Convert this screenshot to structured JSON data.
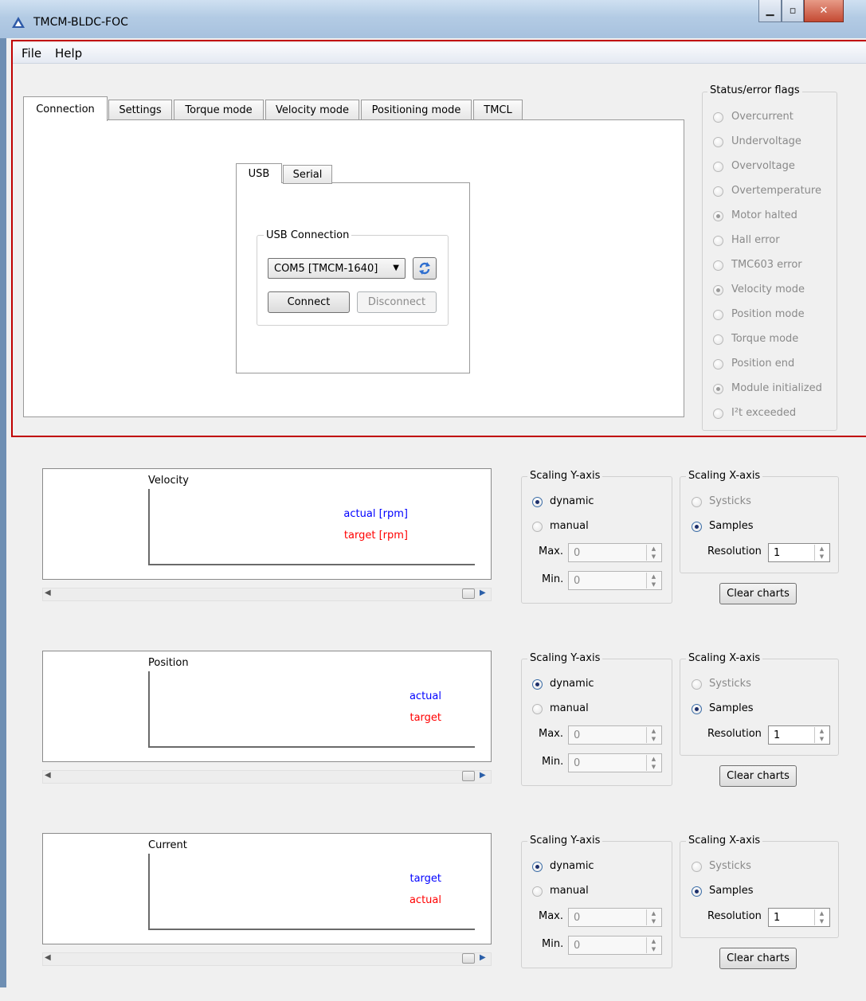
{
  "window": {
    "title": "TMCM-BLDC-FOC",
    "min_icon": "minimize-icon",
    "max_icon": "maximize-icon",
    "close_icon": "close-icon"
  },
  "menu": {
    "file": "File",
    "help": "Help"
  },
  "tabs": [
    "Connection",
    "Settings",
    "Torque mode",
    "Velocity mode",
    "Positioning mode",
    "TMCL"
  ],
  "connection": {
    "subtabs": [
      "USB",
      "Serial"
    ],
    "group_title": "USB Connection",
    "port_value": "COM5  [TMCM-1640]",
    "refresh_icon": "refresh-icon",
    "connect_label": "Connect",
    "disconnect_label": "Disconnect"
  },
  "status": {
    "title": "Status/error flags",
    "flags": [
      {
        "label": "Overcurrent",
        "checked": false
      },
      {
        "label": "Undervoltage",
        "checked": false
      },
      {
        "label": "Overvoltage",
        "checked": false
      },
      {
        "label": "Overtemperature",
        "checked": false
      },
      {
        "label": "Motor halted",
        "checked": true
      },
      {
        "label": "Hall error",
        "checked": false
      },
      {
        "label": "TMC603 error",
        "checked": false
      },
      {
        "label": "Velocity mode",
        "checked": true
      },
      {
        "label": "Position mode",
        "checked": false
      },
      {
        "label": "Torque mode",
        "checked": false
      },
      {
        "label": "Position end",
        "checked": false
      },
      {
        "label": "Module initialized",
        "checked": true
      },
      {
        "label": "I²t exceeded",
        "checked": false
      }
    ]
  },
  "charts": [
    {
      "title": "Velocity",
      "legend1": "actual [rpm]",
      "legend1_color": "#0000ff",
      "legend2": "target [rpm]",
      "legend2_color": "#ff0000"
    },
    {
      "title": "Position",
      "legend1": "actual",
      "legend1_color": "#0000ff",
      "legend2": "target",
      "legend2_color": "#ff0000"
    },
    {
      "title": "Current",
      "legend1": "target",
      "legend1_color": "#0000ff",
      "legend2": "actual",
      "legend2_color": "#ff0000"
    }
  ],
  "scaling": {
    "y_title": "Scaling Y-axis",
    "dynamic": "dynamic",
    "manual": "manual",
    "max_label": "Max.",
    "min_label": "Min.",
    "max_value": "0",
    "min_value": "0",
    "x_title": "Scaling X-axis",
    "systicks": "Systicks",
    "samples": "Samples",
    "resolution_label": "Resolution",
    "resolution_value": "1",
    "clear_label": "Clear charts"
  }
}
